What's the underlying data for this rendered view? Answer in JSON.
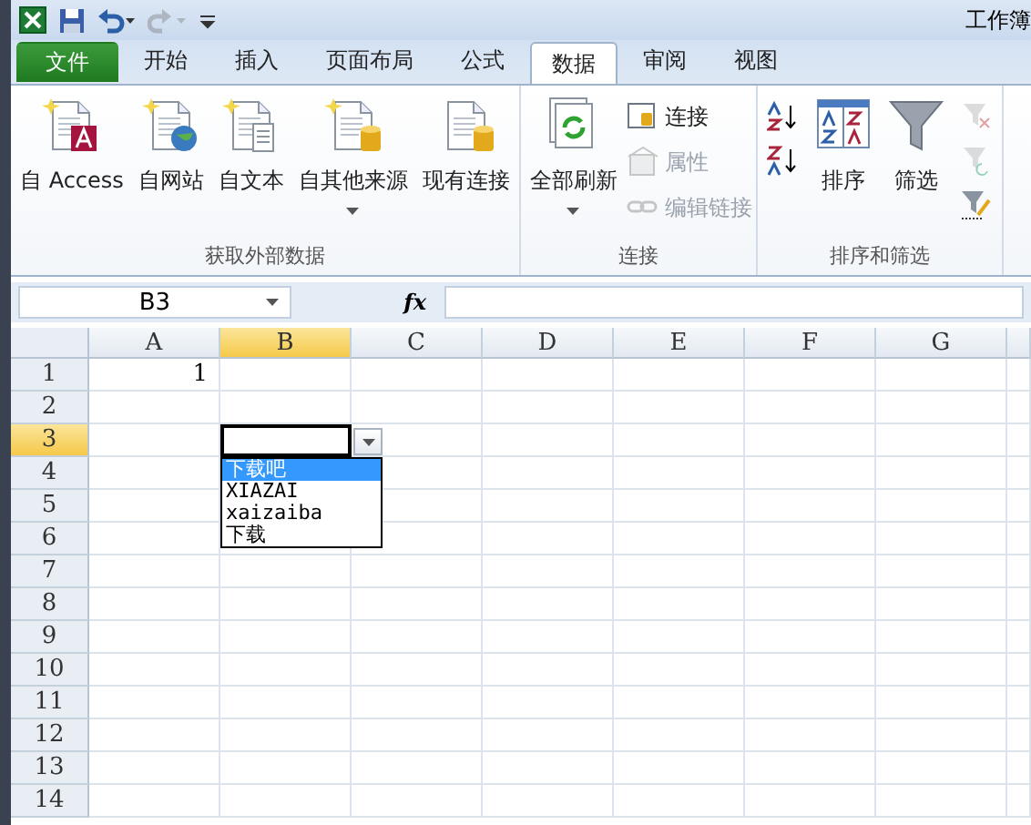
{
  "title_bar": {
    "title": "工作簿"
  },
  "tabs": [
    {
      "label": "文件",
      "kind": "file",
      "selected": false
    },
    {
      "label": "开始",
      "kind": "tab",
      "selected": false
    },
    {
      "label": "插入",
      "kind": "tab",
      "selected": false
    },
    {
      "label": "页面布局",
      "kind": "tab",
      "selected": false
    },
    {
      "label": "公式",
      "kind": "tab",
      "selected": false
    },
    {
      "label": "数据",
      "kind": "tab",
      "selected": true
    },
    {
      "label": "审阅",
      "kind": "tab",
      "selected": false
    },
    {
      "label": "视图",
      "kind": "tab",
      "selected": false
    }
  ],
  "ribbon_groups": [
    {
      "label": "获取外部数据",
      "buttons": [
        {
          "label": "自 Access",
          "kind": "large",
          "dropdown": false,
          "disabled": false
        },
        {
          "label": "自网站",
          "kind": "large",
          "dropdown": false,
          "disabled": false
        },
        {
          "label": "自文本",
          "kind": "large",
          "dropdown": false,
          "disabled": false
        },
        {
          "label": "自其他来源",
          "kind": "large",
          "dropdown": true,
          "disabled": false
        },
        {
          "label": "现有连接",
          "kind": "large",
          "dropdown": false,
          "disabled": false
        }
      ]
    },
    {
      "label": "连接",
      "buttons": [
        {
          "label": "全部刷新",
          "kind": "large",
          "dropdown": true,
          "disabled": false
        },
        {
          "label": "连接",
          "kind": "small",
          "dropdown": false,
          "disabled": false
        },
        {
          "label": "属性",
          "kind": "small",
          "dropdown": false,
          "disabled": true
        },
        {
          "label": "编辑链接",
          "kind": "small",
          "dropdown": false,
          "disabled": true
        }
      ]
    },
    {
      "label": "排序和筛选",
      "buttons": [
        {
          "kind": "icon",
          "dropdown": false,
          "disabled": false
        },
        {
          "kind": "icon",
          "dropdown": false,
          "disabled": false
        },
        {
          "label": "排序",
          "kind": "large",
          "dropdown": false,
          "disabled": false
        },
        {
          "label": "筛选",
          "kind": "large",
          "dropdown": false,
          "disabled": false
        },
        {
          "kind": "icon",
          "dropdown": false,
          "disabled": true
        },
        {
          "kind": "icon",
          "dropdown": false,
          "disabled": true
        },
        {
          "kind": "icon",
          "dropdown": false,
          "disabled": false
        }
      ]
    }
  ],
  "formula_bar": {
    "name_box": "B3",
    "function_label": "fx"
  },
  "columns": [
    {
      "label": "A",
      "selected": false
    },
    {
      "label": "B",
      "selected": true
    },
    {
      "label": "C",
      "selected": false
    },
    {
      "label": "D",
      "selected": false
    },
    {
      "label": "E",
      "selected": false
    },
    {
      "label": "F",
      "selected": false
    },
    {
      "label": "G",
      "selected": false
    }
  ],
  "rows": [
    {
      "label": "1",
      "selected": false,
      "cells": [
        "1"
      ]
    },
    {
      "label": "2",
      "selected": false,
      "cells": []
    },
    {
      "label": "3",
      "selected": true,
      "cells": []
    },
    {
      "label": "4",
      "selected": false,
      "cells": []
    },
    {
      "label": "5",
      "selected": false,
      "cells": []
    },
    {
      "label": "6",
      "selected": false,
      "cells": []
    },
    {
      "label": "7",
      "selected": false,
      "cells": []
    },
    {
      "label": "8",
      "selected": false,
      "cells": []
    },
    {
      "label": "9",
      "selected": false,
      "cells": []
    },
    {
      "label": "10",
      "selected": false,
      "cells": []
    },
    {
      "label": "11",
      "selected": false,
      "cells": []
    },
    {
      "label": "12",
      "selected": false,
      "cells": []
    },
    {
      "label": "13",
      "selected": false,
      "cells": []
    },
    {
      "label": "14",
      "selected": false,
      "cells": []
    }
  ],
  "dropdown_list": {
    "items": [
      {
        "label": "下载吧",
        "selected": true
      },
      {
        "label": "XIAZAI",
        "selected": false
      },
      {
        "label": "xaizaiba",
        "selected": false
      },
      {
        "label": "下载",
        "selected": false
      }
    ]
  }
}
